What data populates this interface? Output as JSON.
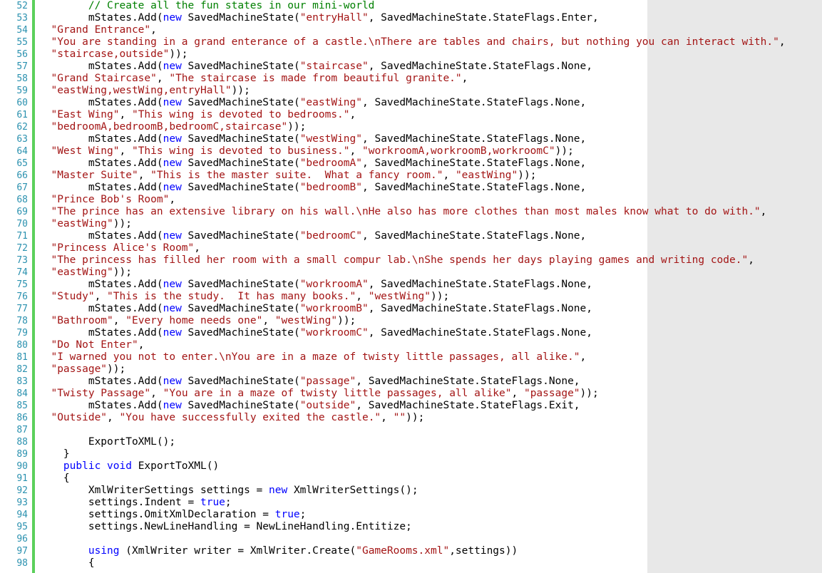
{
  "editor": {
    "colors": {
      "keyword": "#0000ff",
      "string": "#a31515",
      "comment": "#008000",
      "line_number": "#2b91af",
      "change_bar": "#5bd05b"
    },
    "lines": [
      {
        "num": "52",
        "tokens": [
          {
            "t": "cm",
            "v": "        // Create all the fun states in our mini-world"
          }
        ]
      },
      {
        "num": "53",
        "tokens": [
          {
            "t": "p",
            "v": "        mStates.Add("
          },
          {
            "t": "kw",
            "v": "new"
          },
          {
            "t": "p",
            "v": " SavedMachineState("
          },
          {
            "t": "str",
            "v": "\"entryHall\""
          },
          {
            "t": "p",
            "v": ", SavedMachineState.StateFlags.Enter,"
          }
        ]
      },
      {
        "num": "54",
        "tokens": [
          {
            "t": "p",
            "v": "  "
          },
          {
            "t": "str",
            "v": "\"Grand Entrance\""
          },
          {
            "t": "p",
            "v": ","
          }
        ]
      },
      {
        "num": "55",
        "tokens": [
          {
            "t": "p",
            "v": "  "
          },
          {
            "t": "str",
            "v": "\"You are standing in a grand enterance of a castle.\\nThere are tables and chairs, but nothing you can interact with.\""
          },
          {
            "t": "p",
            "v": ","
          }
        ]
      },
      {
        "num": "56",
        "tokens": [
          {
            "t": "p",
            "v": "  "
          },
          {
            "t": "str",
            "v": "\"staircase,outside\""
          },
          {
            "t": "p",
            "v": "));"
          }
        ]
      },
      {
        "num": "57",
        "tokens": [
          {
            "t": "p",
            "v": "        mStates.Add("
          },
          {
            "t": "kw",
            "v": "new"
          },
          {
            "t": "p",
            "v": " SavedMachineState("
          },
          {
            "t": "str",
            "v": "\"staircase\""
          },
          {
            "t": "p",
            "v": ", SavedMachineState.StateFlags.None,"
          }
        ]
      },
      {
        "num": "58",
        "tokens": [
          {
            "t": "p",
            "v": "  "
          },
          {
            "t": "str",
            "v": "\"Grand Staircase\""
          },
          {
            "t": "p",
            "v": ", "
          },
          {
            "t": "str",
            "v": "\"The staircase is made from beautiful granite.\""
          },
          {
            "t": "p",
            "v": ","
          }
        ]
      },
      {
        "num": "59",
        "tokens": [
          {
            "t": "p",
            "v": "  "
          },
          {
            "t": "str",
            "v": "\"eastWing,westWing,entryHall\""
          },
          {
            "t": "p",
            "v": "));"
          }
        ]
      },
      {
        "num": "60",
        "tokens": [
          {
            "t": "p",
            "v": "        mStates.Add("
          },
          {
            "t": "kw",
            "v": "new"
          },
          {
            "t": "p",
            "v": " SavedMachineState("
          },
          {
            "t": "str",
            "v": "\"eastWing\""
          },
          {
            "t": "p",
            "v": ", SavedMachineState.StateFlags.None,"
          }
        ]
      },
      {
        "num": "61",
        "tokens": [
          {
            "t": "p",
            "v": "  "
          },
          {
            "t": "str",
            "v": "\"East Wing\""
          },
          {
            "t": "p",
            "v": ", "
          },
          {
            "t": "str",
            "v": "\"This wing is devoted to bedrooms.\""
          },
          {
            "t": "p",
            "v": ","
          }
        ]
      },
      {
        "num": "62",
        "tokens": [
          {
            "t": "p",
            "v": "  "
          },
          {
            "t": "str",
            "v": "\"bedroomA,bedroomB,bedroomC,staircase\""
          },
          {
            "t": "p",
            "v": "));"
          }
        ]
      },
      {
        "num": "63",
        "tokens": [
          {
            "t": "p",
            "v": "        mStates.Add("
          },
          {
            "t": "kw",
            "v": "new"
          },
          {
            "t": "p",
            "v": " SavedMachineState("
          },
          {
            "t": "str",
            "v": "\"westWing\""
          },
          {
            "t": "p",
            "v": ", SavedMachineState.StateFlags.None,"
          }
        ]
      },
      {
        "num": "64",
        "tokens": [
          {
            "t": "p",
            "v": "  "
          },
          {
            "t": "str",
            "v": "\"West Wing\""
          },
          {
            "t": "p",
            "v": ", "
          },
          {
            "t": "str",
            "v": "\"This wing is devoted to business.\""
          },
          {
            "t": "p",
            "v": ", "
          },
          {
            "t": "str",
            "v": "\"workroomA,workroomB,workroomC\""
          },
          {
            "t": "p",
            "v": "));"
          }
        ]
      },
      {
        "num": "65",
        "tokens": [
          {
            "t": "p",
            "v": "        mStates.Add("
          },
          {
            "t": "kw",
            "v": "new"
          },
          {
            "t": "p",
            "v": " SavedMachineState("
          },
          {
            "t": "str",
            "v": "\"bedroomA\""
          },
          {
            "t": "p",
            "v": ", SavedMachineState.StateFlags.None,"
          }
        ]
      },
      {
        "num": "66",
        "tokens": [
          {
            "t": "p",
            "v": "  "
          },
          {
            "t": "str",
            "v": "\"Master Suite\""
          },
          {
            "t": "p",
            "v": ", "
          },
          {
            "t": "str",
            "v": "\"This is the master suite.  What a fancy room.\""
          },
          {
            "t": "p",
            "v": ", "
          },
          {
            "t": "str",
            "v": "\"eastWing\""
          },
          {
            "t": "p",
            "v": "));"
          }
        ]
      },
      {
        "num": "67",
        "tokens": [
          {
            "t": "p",
            "v": "        mStates.Add("
          },
          {
            "t": "kw",
            "v": "new"
          },
          {
            "t": "p",
            "v": " SavedMachineState("
          },
          {
            "t": "str",
            "v": "\"bedroomB\""
          },
          {
            "t": "p",
            "v": ", SavedMachineState.StateFlags.None,"
          }
        ]
      },
      {
        "num": "68",
        "tokens": [
          {
            "t": "p",
            "v": "  "
          },
          {
            "t": "str",
            "v": "\"Prince Bob's Room\""
          },
          {
            "t": "p",
            "v": ","
          }
        ]
      },
      {
        "num": "69",
        "tokens": [
          {
            "t": "p",
            "v": "  "
          },
          {
            "t": "str",
            "v": "\"The prince has an extensive library on his wall.\\nHe also has more clothes than most males know what to do with.\""
          },
          {
            "t": "p",
            "v": ","
          }
        ]
      },
      {
        "num": "70",
        "tokens": [
          {
            "t": "p",
            "v": "  "
          },
          {
            "t": "str",
            "v": "\"eastWing\""
          },
          {
            "t": "p",
            "v": "));"
          }
        ]
      },
      {
        "num": "71",
        "tokens": [
          {
            "t": "p",
            "v": "        mStates.Add("
          },
          {
            "t": "kw",
            "v": "new"
          },
          {
            "t": "p",
            "v": " SavedMachineState("
          },
          {
            "t": "str",
            "v": "\"bedroomC\""
          },
          {
            "t": "p",
            "v": ", SavedMachineState.StateFlags.None,"
          }
        ]
      },
      {
        "num": "72",
        "tokens": [
          {
            "t": "p",
            "v": "  "
          },
          {
            "t": "str",
            "v": "\"Princess Alice's Room\""
          },
          {
            "t": "p",
            "v": ","
          }
        ]
      },
      {
        "num": "73",
        "tokens": [
          {
            "t": "p",
            "v": "  "
          },
          {
            "t": "str",
            "v": "\"The princess has filled her room with a small compur lab.\\nShe spends her days playing games and writing code.\""
          },
          {
            "t": "p",
            "v": ","
          }
        ]
      },
      {
        "num": "74",
        "tokens": [
          {
            "t": "p",
            "v": "  "
          },
          {
            "t": "str",
            "v": "\"eastWing\""
          },
          {
            "t": "p",
            "v": "));"
          }
        ]
      },
      {
        "num": "75",
        "tokens": [
          {
            "t": "p",
            "v": "        mStates.Add("
          },
          {
            "t": "kw",
            "v": "new"
          },
          {
            "t": "p",
            "v": " SavedMachineState("
          },
          {
            "t": "str",
            "v": "\"workroomA\""
          },
          {
            "t": "p",
            "v": ", SavedMachineState.StateFlags.None,"
          }
        ]
      },
      {
        "num": "76",
        "tokens": [
          {
            "t": "p",
            "v": "  "
          },
          {
            "t": "str",
            "v": "\"Study\""
          },
          {
            "t": "p",
            "v": ", "
          },
          {
            "t": "str",
            "v": "\"This is the study.  It has many books.\""
          },
          {
            "t": "p",
            "v": ", "
          },
          {
            "t": "str",
            "v": "\"westWing\""
          },
          {
            "t": "p",
            "v": "));"
          }
        ]
      },
      {
        "num": "77",
        "tokens": [
          {
            "t": "p",
            "v": "        mStates.Add("
          },
          {
            "t": "kw",
            "v": "new"
          },
          {
            "t": "p",
            "v": " SavedMachineState("
          },
          {
            "t": "str",
            "v": "\"workroomB\""
          },
          {
            "t": "p",
            "v": ", SavedMachineState.StateFlags.None,"
          }
        ]
      },
      {
        "num": "78",
        "tokens": [
          {
            "t": "p",
            "v": "  "
          },
          {
            "t": "str",
            "v": "\"Bathroom\""
          },
          {
            "t": "p",
            "v": ", "
          },
          {
            "t": "str",
            "v": "\"Every home needs one\""
          },
          {
            "t": "p",
            "v": ", "
          },
          {
            "t": "str",
            "v": "\"westWing\""
          },
          {
            "t": "p",
            "v": "));"
          }
        ]
      },
      {
        "num": "79",
        "tokens": [
          {
            "t": "p",
            "v": "        mStates.Add("
          },
          {
            "t": "kw",
            "v": "new"
          },
          {
            "t": "p",
            "v": " SavedMachineState("
          },
          {
            "t": "str",
            "v": "\"workroomC\""
          },
          {
            "t": "p",
            "v": ", SavedMachineState.StateFlags.None,"
          }
        ]
      },
      {
        "num": "80",
        "tokens": [
          {
            "t": "p",
            "v": "  "
          },
          {
            "t": "str",
            "v": "\"Do Not Enter\""
          },
          {
            "t": "p",
            "v": ","
          }
        ]
      },
      {
        "num": "81",
        "tokens": [
          {
            "t": "p",
            "v": "  "
          },
          {
            "t": "str",
            "v": "\"I warned you not to enter.\\nYou are in a maze of twisty little passages, all alike.\""
          },
          {
            "t": "p",
            "v": ","
          }
        ]
      },
      {
        "num": "82",
        "tokens": [
          {
            "t": "p",
            "v": "  "
          },
          {
            "t": "str",
            "v": "\"passage\""
          },
          {
            "t": "p",
            "v": "));"
          }
        ]
      },
      {
        "num": "83",
        "tokens": [
          {
            "t": "p",
            "v": "        mStates.Add("
          },
          {
            "t": "kw",
            "v": "new"
          },
          {
            "t": "p",
            "v": " SavedMachineState("
          },
          {
            "t": "str",
            "v": "\"passage\""
          },
          {
            "t": "p",
            "v": ", SavedMachineState.StateFlags.None,"
          }
        ]
      },
      {
        "num": "84",
        "tokens": [
          {
            "t": "p",
            "v": "  "
          },
          {
            "t": "str",
            "v": "\"Twisty Passage\""
          },
          {
            "t": "p",
            "v": ", "
          },
          {
            "t": "str",
            "v": "\"You are in a maze of twisty little passages, all alike\""
          },
          {
            "t": "p",
            "v": ", "
          },
          {
            "t": "str",
            "v": "\"passage\""
          },
          {
            "t": "p",
            "v": "));"
          }
        ]
      },
      {
        "num": "85",
        "tokens": [
          {
            "t": "p",
            "v": "        mStates.Add("
          },
          {
            "t": "kw",
            "v": "new"
          },
          {
            "t": "p",
            "v": " SavedMachineState("
          },
          {
            "t": "str",
            "v": "\"outside\""
          },
          {
            "t": "p",
            "v": ", SavedMachineState.StateFlags.Exit,"
          }
        ]
      },
      {
        "num": "86",
        "tokens": [
          {
            "t": "p",
            "v": "  "
          },
          {
            "t": "str",
            "v": "\"Outside\""
          },
          {
            "t": "p",
            "v": ", "
          },
          {
            "t": "str",
            "v": "\"You have successfully exited the castle.\""
          },
          {
            "t": "p",
            "v": ", "
          },
          {
            "t": "str",
            "v": "\"\""
          },
          {
            "t": "p",
            "v": "));"
          }
        ]
      },
      {
        "num": "87",
        "tokens": []
      },
      {
        "num": "88",
        "tokens": [
          {
            "t": "p",
            "v": "        ExportToXML();"
          }
        ]
      },
      {
        "num": "89",
        "tokens": [
          {
            "t": "p",
            "v": "    }"
          }
        ]
      },
      {
        "num": "90",
        "tokens": [
          {
            "t": "p",
            "v": "    "
          },
          {
            "t": "kw",
            "v": "public"
          },
          {
            "t": "p",
            "v": " "
          },
          {
            "t": "kw",
            "v": "void"
          },
          {
            "t": "p",
            "v": " ExportToXML()"
          }
        ]
      },
      {
        "num": "91",
        "tokens": [
          {
            "t": "p",
            "v": "    {"
          }
        ]
      },
      {
        "num": "92",
        "tokens": [
          {
            "t": "p",
            "v": "        XmlWriterSettings settings = "
          },
          {
            "t": "kw",
            "v": "new"
          },
          {
            "t": "p",
            "v": " XmlWriterSettings();"
          }
        ]
      },
      {
        "num": "93",
        "tokens": [
          {
            "t": "p",
            "v": "        settings.Indent = "
          },
          {
            "t": "kw",
            "v": "true"
          },
          {
            "t": "p",
            "v": ";"
          }
        ]
      },
      {
        "num": "94",
        "tokens": [
          {
            "t": "p",
            "v": "        settings.OmitXmlDeclaration = "
          },
          {
            "t": "kw",
            "v": "true"
          },
          {
            "t": "p",
            "v": ";"
          }
        ]
      },
      {
        "num": "95",
        "tokens": [
          {
            "t": "p",
            "v": "        settings.NewLineHandling = NewLineHandling.Entitize;"
          }
        ]
      },
      {
        "num": "96",
        "tokens": []
      },
      {
        "num": "97",
        "tokens": [
          {
            "t": "p",
            "v": "        "
          },
          {
            "t": "kw",
            "v": "using"
          },
          {
            "t": "p",
            "v": " (XmlWriter writer = XmlWriter.Create("
          },
          {
            "t": "str",
            "v": "\"GameRooms.xml\""
          },
          {
            "t": "p",
            "v": ",settings))"
          }
        ]
      },
      {
        "num": "98",
        "tokens": [
          {
            "t": "p",
            "v": "        {"
          }
        ]
      }
    ]
  }
}
